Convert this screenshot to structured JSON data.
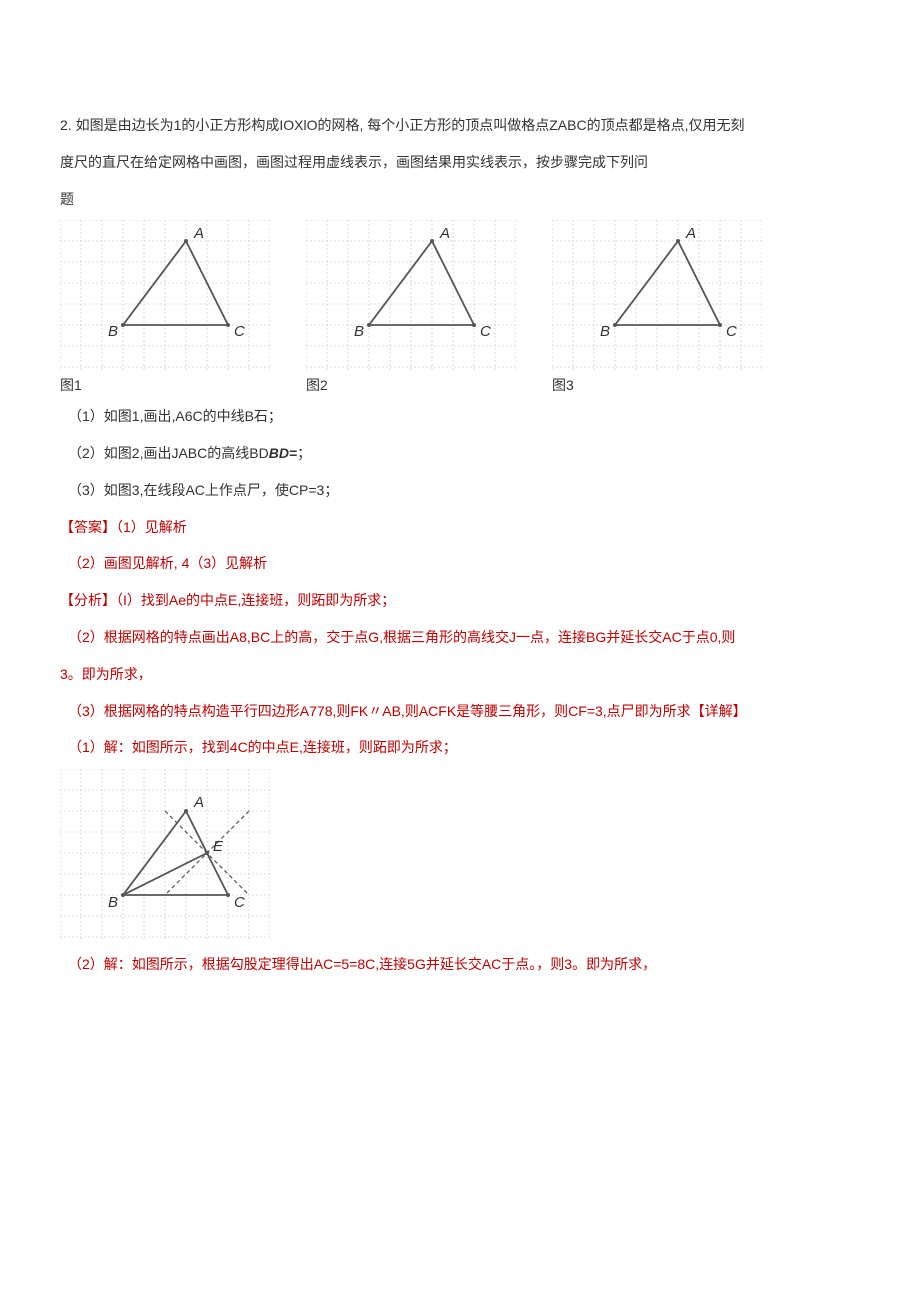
{
  "q": {
    "num": "2. ",
    "stem1": "如图是由边长为1的小正方形构成IOXlO的网格, 每个小正方形的顶点叫做格点ZABC的顶点都是格点,仅用无刻",
    "stem2": "度尺的直尺在给定网格中画图，画图过程用虚线表示，画图结果用实线表示，按步骤完成下列问",
    "stem3": "题"
  },
  "figLabels": {
    "f1": "图1",
    "f2": "图2",
    "f3": "图3"
  },
  "vertices": {
    "A": "A",
    "B": "B",
    "C": "C",
    "E": "E"
  },
  "parts": {
    "p1": "（1）如图1,画出,A6C的中线B石；",
    "p2a": "（2）如图2,画出JABC的高线BD",
    "p2b": "BD=",
    "p2c": "；",
    "p3": "（3）如图3,在线段AC上作点尸，使CP=3；"
  },
  "answer": {
    "head": "【答案】（1）见解析",
    "line2": "（2）画图见解析, 4（3）见解析"
  },
  "analysis": {
    "head": "【分析】（I）找到Ae的中点E,连接班，则跖即为所求；",
    "l2a": "（2）根据网格的特点画出A8,BC上的高，交于点G,根据三角形的高线交J一点，连接BG并延长交AC于点0,则",
    "l2b": "3。即为所求，",
    "l3a": "（3）根据网格的特点构造平行四边形A778,则FK〃AB,则ACFK是等腰三角形，则CF=3,点尸即为所求",
    "detailTag": "【详解】"
  },
  "solutions": {
    "s1": "（1）解：如图所示，找到4C的中点E,连接班，则跖即为所求；",
    "s2": "（2）解：如图所示，根据勾股定理得出AC=5=8C,连接5G并延长交AC于点。，则3。即为所求，"
  }
}
